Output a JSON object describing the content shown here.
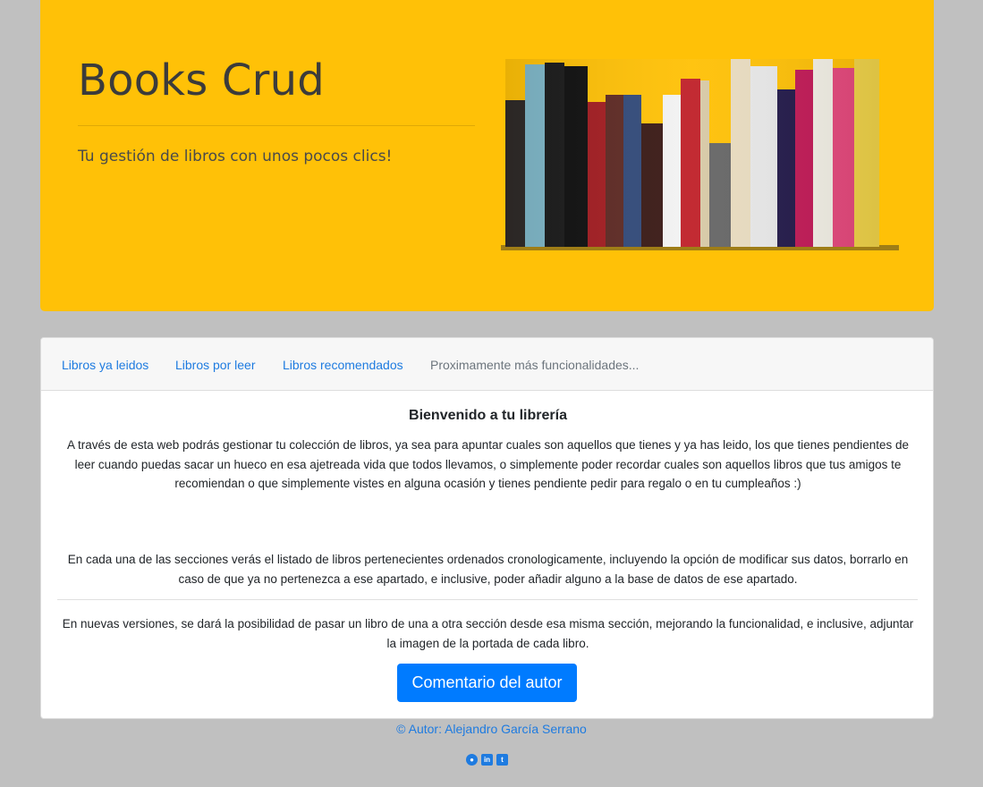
{
  "jumbotron": {
    "title": "Books Crud",
    "lead": "Tu gestión de libros con unos pocos clics!"
  },
  "nav": {
    "items": [
      {
        "label": "Libros ya leidos"
      },
      {
        "label": "Libros por leer"
      },
      {
        "label": "Libros recomendados"
      },
      {
        "label": "Proximamente más funcionalidades..."
      }
    ]
  },
  "card": {
    "title": "Bienvenido a tu librería",
    "para1": "A través de esta web podrás gestionar tu colección de libros, ya sea para apuntar cuales son aquellos que tienes y ya has leido, los que tienes pendientes de leer cuando puedas sacar un hueco en esa ajetreada vida que todos llevamos, o simplemente poder recordar cuales son aquellos libros que tus amigos te recomiendan o que simplemente vistes en alguna ocasión y tienes pendiente pedir para regalo o en tu cumpleaños :)",
    "para2": "En cada una de las secciones verás el listado de libros pertenecientes ordenados cronologicamente, incluyendo la opción de modificar sus datos, borrarlo en caso de que ya no pertenezca a ese apartado, e inclusive, poder añadir alguno a la base de datos de ese apartado.",
    "para3": "En nuevas versiones, se dará la posibilidad de pasar un libro de una a otra sección desde esa misma sección, mejorando la funcionalidad, e inclusive, adjuntar la imagen de la portada de cada libro.",
    "button_label": "Comentario del autor"
  },
  "footer": {
    "author": "© Autor: Alejandro García Serrano",
    "social": [
      {
        "icon": "github-icon",
        "glyph": "●"
      },
      {
        "icon": "linkedin-icon",
        "glyph": "in"
      },
      {
        "icon": "twitter-icon",
        "glyph": "t"
      }
    ]
  },
  "colors": {
    "jumbotron_bg": "#ffc107",
    "page_bg": "#c0c0c0",
    "primary": "#007bff",
    "link": "#1e7be0"
  }
}
